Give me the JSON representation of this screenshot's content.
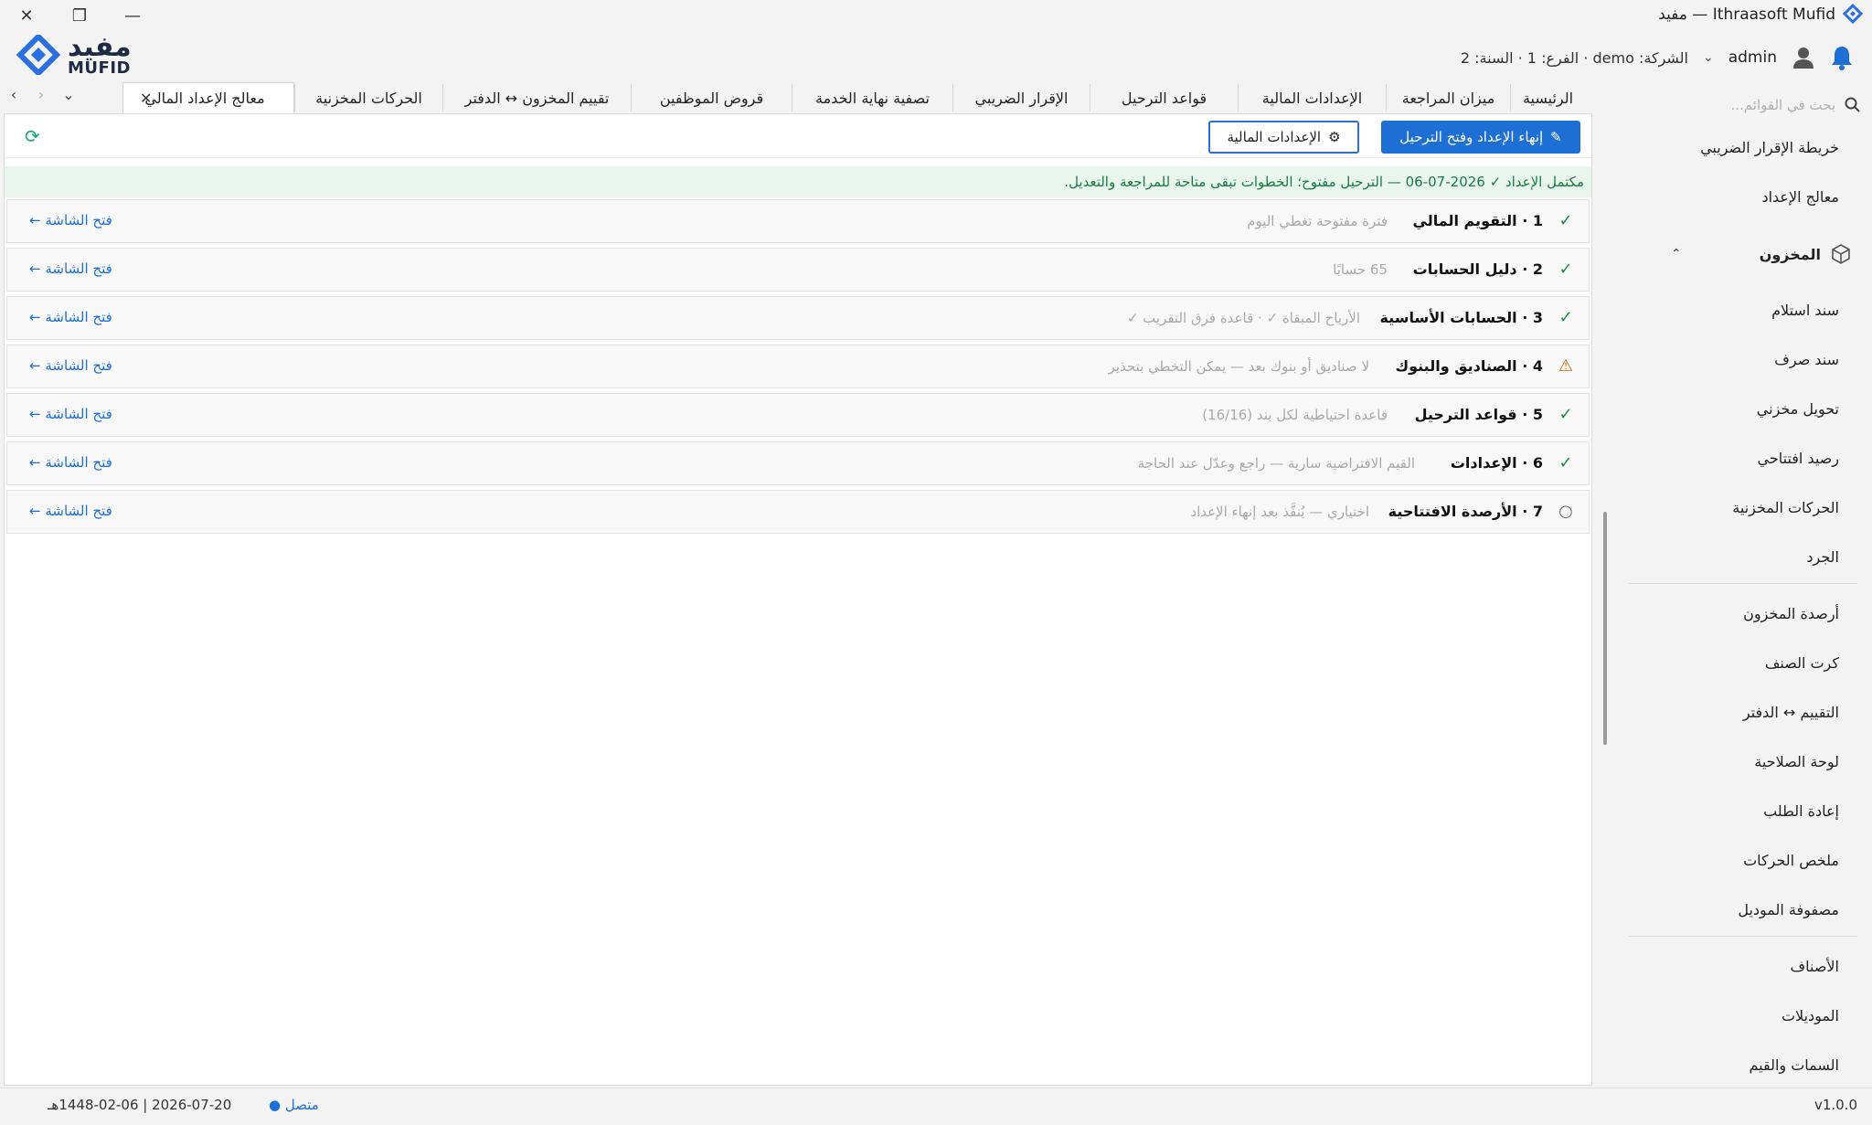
{
  "window": {
    "title": "Ithraasoft Mufid — مفيد",
    "controls": {
      "close": "✕",
      "restore": "❐",
      "minimize": "—"
    }
  },
  "logo": {
    "arabic": "مفيد",
    "english": "MUFID"
  },
  "header": {
    "user": "admin",
    "company_info": "الشركة: demo · الفرع: 1 · السنة: 2"
  },
  "tabs": {
    "items": [
      {
        "label": "الرئيسية"
      },
      {
        "label": "ميزان المراجعة"
      },
      {
        "label": "الإعدادات المالية"
      },
      {
        "label": "قواعد الترحيل"
      },
      {
        "label": "الإقرار الضريبي"
      },
      {
        "label": "تصفية نهاية الخدمة"
      },
      {
        "label": "قروض الموظفين"
      },
      {
        "label": "تقييم المخزون ↔ الدفتر"
      },
      {
        "label": "الحركات المخزنية"
      },
      {
        "label": "معالج الإعداد المالي",
        "active": true
      }
    ]
  },
  "toolbar": {
    "finish_button": "إنهاء الإعداد وفتح الترحيل",
    "settings_button": "الإعدادات المالية"
  },
  "status_banner": "مكتمل الإعداد ✓ 2026-07-06 — الترحيل مفتوح؛ الخطوات تبقى متاحة للمراجعة والتعديل.",
  "steps": [
    {
      "title": "1 · التقويم المالي",
      "note": "فترة مفتوحة تغطي اليوم",
      "status": "ok",
      "link": "فتح الشاشة ←"
    },
    {
      "title": "2 · دليل الحسابات",
      "note": "65 حسابًا",
      "status": "ok",
      "link": "فتح الشاشة ←"
    },
    {
      "title": "3 · الحسابات الأساسية",
      "note": "الأرباح المبقاة ✓ · قاعدة فرق التقريب ✓",
      "status": "ok",
      "link": "فتح الشاشة ←"
    },
    {
      "title": "4 · الصناديق والبنوك",
      "note": "لا صناديق أو بنوك بعد — يمكن التخطي بتحذير",
      "status": "warn",
      "link": "فتح الشاشة ←"
    },
    {
      "title": "5 · قواعد الترحيل",
      "note": "قاعدة احتياطية لكل بند (16/16)",
      "status": "ok",
      "link": "فتح الشاشة ←"
    },
    {
      "title": "6 · الإعدادات",
      "note": "القيم الافتراضية سارية — راجع وعدّل عند الحاجة",
      "status": "ok",
      "link": "فتح الشاشة ←"
    },
    {
      "title": "7 · الأرصدة الافتتاحية",
      "note": "اختياري — يُنفَّذ بعد إنهاء الإعداد",
      "status": "pending",
      "link": "فتح الشاشة ←"
    }
  ],
  "step_icons": {
    "ok": "✓",
    "warn": "⚠",
    "pending": "○"
  },
  "sidebar": {
    "search_placeholder": "بحث في القوائم...",
    "top_items": [
      "خريطة الإقرار الضريبي",
      "معالج الإعداد"
    ],
    "group": "المخزون",
    "group_items": [
      "سند استلام",
      "سند صرف",
      "تحويل مخزني",
      "رصيد افتتاحي",
      "الحركات المخزنية",
      "الجرد"
    ],
    "report_items": [
      "أرصدة المخزون",
      "كرت الصنف",
      "التقييم ↔ الدفتر",
      "لوحة الصلاحية",
      "إعادة الطلب",
      "ملخص الحركات",
      "مصفوفة الموديل"
    ],
    "master_items": [
      "الأصناف",
      "الموديلات",
      "السمات والقيم"
    ]
  },
  "statusbar": {
    "version": "v1.0.0",
    "connection": "متصل ●",
    "date": "2026-07-20 | 1448-02-06هـ"
  },
  "colors": {
    "primary": "#1e6fd4",
    "success": "#1b8f4a",
    "warning": "#c66a00",
    "banner_bg": "#e8f6ee"
  }
}
